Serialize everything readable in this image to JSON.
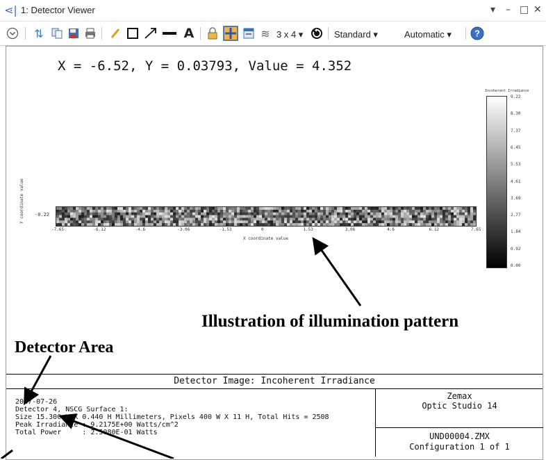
{
  "window": {
    "icon": "detector-viewer-icon",
    "title": "1: Detector Viewer",
    "controls": {
      "menu": "▾",
      "minimize": "–",
      "maximize": "□",
      "close": "✕"
    }
  },
  "toolbar": {
    "layout_label": "3 x 4 ▾",
    "mode_label": "Standard ▾",
    "scale_label": "Automatic ▾",
    "icons": [
      "collapse-icon",
      "refresh-icon",
      "copy-icon",
      "save-icon",
      "print-icon",
      "pencil-icon",
      "rectangle-icon",
      "arrow-icon",
      "line-icon",
      "text-icon",
      "lock-icon",
      "grid-icon",
      "window-icon",
      "layers-icon",
      "layout-icon",
      "rotate-icon",
      "help-icon"
    ]
  },
  "coordinate_readout": "X = -6.52, Y = 0.03793, Value = 4.352",
  "plot": {
    "y_tick": "-0.22",
    "y_axis_label": "Y coordinate value",
    "x_axis_label": "X coordinate value",
    "x_ticks": [
      "-7.65",
      "-6.12",
      "-4.6",
      "-3.06",
      "-1.53",
      "0",
      "1.53",
      "3.06",
      "4.6",
      "6.12",
      "7.65"
    ],
    "colorbar_title": "Incoherent Irradiance",
    "colorbar_ticks": [
      "9.22",
      "8.30",
      "7.37",
      "6.45",
      "5.53",
      "4.61",
      "3.69",
      "2.77",
      "1.84",
      "0.92",
      "0.00"
    ]
  },
  "annotations": {
    "illumination": "Illustration of illumination pattern",
    "detector_area": "Detector Area"
  },
  "info": {
    "title": "Detector Image: Incoherent Irradiance",
    "lines": [
      "2017-07-26",
      "Detector 4, NSCG Surface 1:",
      "Size 15.300 W X 0.440 H Millimeters, Pixels 400 W X 11 H, Total Hits = 2508",
      "Peak Irradiance : 9.2175E+00 Watts/cm^2",
      "Total Power     : 2.5080E-01 Watts"
    ],
    "vendor": "Zemax",
    "product": "Optic Studio 14",
    "file": "UND00004.ZMX",
    "config": "Configuration 1 of 1"
  }
}
